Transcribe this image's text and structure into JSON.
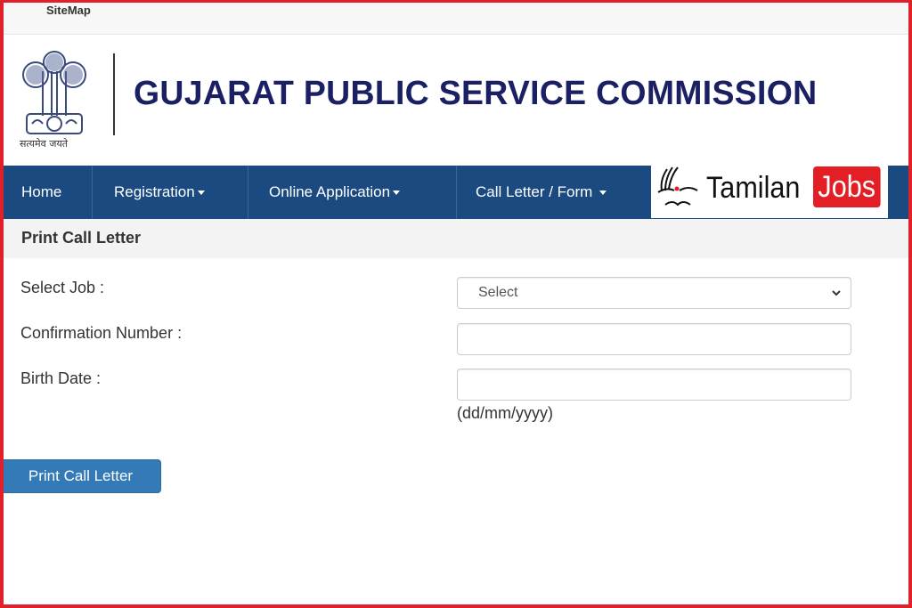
{
  "topbar": {
    "sitemap_label": "SiteMap"
  },
  "header": {
    "emblem_motto": "सत्यमेव जयते",
    "title": "GUJARAT PUBLIC SERVICE COMMISSION",
    "title_color": "#1a2063"
  },
  "navbar": {
    "background": "#1b4a80",
    "items": [
      {
        "label": "Home",
        "has_dropdown": false
      },
      {
        "label": "Registration",
        "has_dropdown": true
      },
      {
        "label": "Online Application",
        "has_dropdown": true
      },
      {
        "label": "Call Letter / Form",
        "has_dropdown": true
      }
    ]
  },
  "watermark": {
    "text": "Tamilan",
    "badge": "Jobs",
    "badge_color": "#e31e24"
  },
  "panel": {
    "title": "Print Call Letter"
  },
  "form": {
    "select_job": {
      "label": "Select Job :",
      "selected": "Select"
    },
    "confirmation_number": {
      "label": "Confirmation Number :",
      "value": ""
    },
    "birth_date": {
      "label": "Birth Date :",
      "value": "",
      "hint": "(dd/mm/yyyy)"
    },
    "submit_label": "Print Call Letter"
  },
  "colors": {
    "frame": "#e0202a",
    "button": "#337ab7"
  }
}
